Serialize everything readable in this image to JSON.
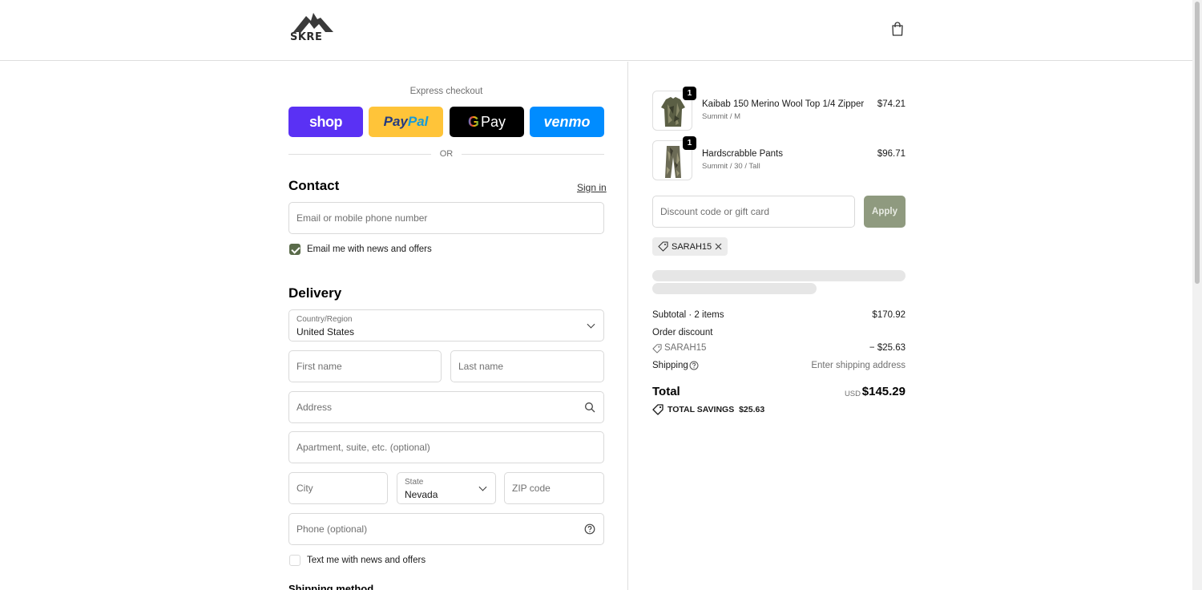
{
  "header": {
    "logo_text": "SKRE"
  },
  "express": {
    "label": "Express checkout",
    "shop_label": "shop",
    "paypal_label_1": "Pay",
    "paypal_label_2": "Pal",
    "gpay_g": "G",
    "gpay_label": "Pay",
    "venmo_label": "venmo",
    "or_text": "OR"
  },
  "contact": {
    "title": "Contact",
    "sign_in": "Sign in",
    "email_placeholder": "Email or mobile phone number",
    "email_news_label": "Email me with news and offers",
    "email_news_checked": true
  },
  "delivery": {
    "title": "Delivery",
    "country_label": "Country/Region",
    "country_value": "United States",
    "first_name_placeholder": "First name",
    "last_name_placeholder": "Last name",
    "address_placeholder": "Address",
    "apartment_placeholder": "Apartment, suite, etc. (optional)",
    "city_placeholder": "City",
    "state_label": "State",
    "state_value": "Nevada",
    "zip_placeholder": "ZIP code",
    "phone_placeholder": "Phone (optional)",
    "text_news_label": "Text me with news and offers",
    "text_news_checked": false,
    "shipping_method_title": "Shipping method"
  },
  "order": {
    "items": [
      {
        "qty": "1",
        "name": "Kaibab 150 Merino Wool Top 1/4 Zipper",
        "variant": "Summit / M",
        "price": "$74.21"
      },
      {
        "qty": "1",
        "name": "Hardscrabble Pants",
        "variant": "Summit / 30 / Tall",
        "price": "$96.71"
      }
    ],
    "discount_placeholder": "Discount code or gift card",
    "apply_label": "Apply",
    "applied_code": "SARAH15",
    "subtotal_label": "Subtotal · 2 items",
    "subtotal_value": "$170.92",
    "order_discount_label": "Order discount",
    "discount_code": "SARAH15",
    "discount_value": "− $25.63",
    "shipping_label": "Shipping",
    "shipping_value": "Enter shipping address",
    "total_label": "Total",
    "total_currency": "USD",
    "total_value": "$145.29",
    "savings_label": "TOTAL SAVINGS",
    "savings_value": "$25.63"
  },
  "colors": {
    "shop": "#5a31f4",
    "paypal": "#ffc439",
    "gpay": "#000000",
    "venmo": "#008cff",
    "accent_green": "#5a6b4a",
    "apply_button": "#8f9a7f"
  }
}
